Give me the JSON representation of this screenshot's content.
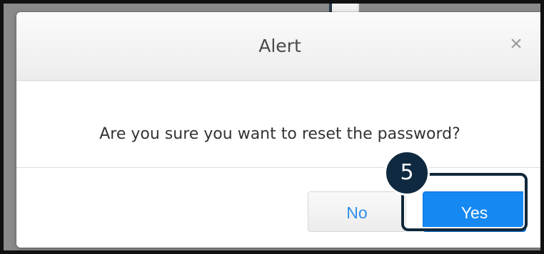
{
  "dialog": {
    "title": "Alert",
    "close_label": "×",
    "message": "Are you sure you want to reset the password?",
    "buttons": {
      "no": "No",
      "yes": "Yes"
    }
  },
  "annotation": {
    "step": "5"
  },
  "colors": {
    "primary_button": "#1688f2",
    "link_text": "#2f8ee8",
    "annotation_dark": "#10283a"
  }
}
